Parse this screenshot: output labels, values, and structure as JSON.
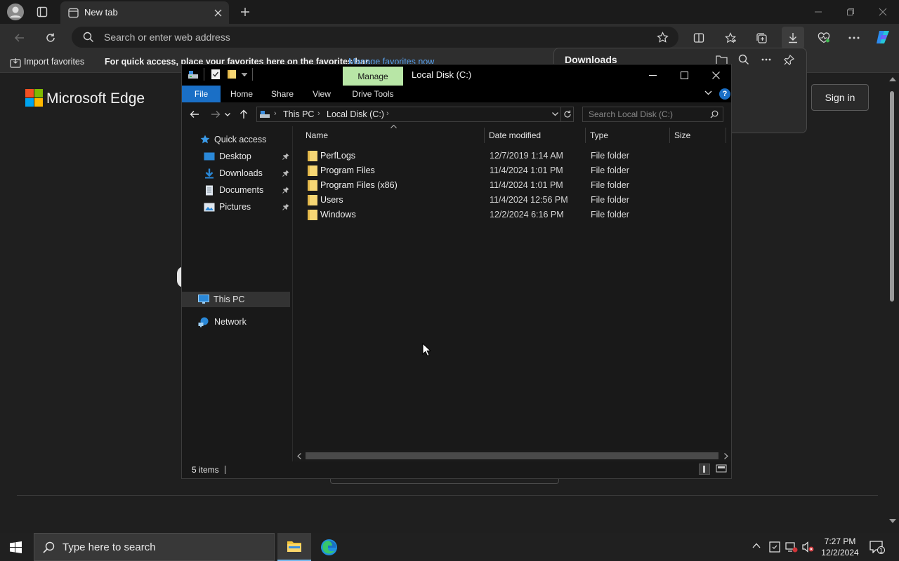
{
  "browser": {
    "tab_title": "New tab",
    "address_placeholder": "Search or enter web address",
    "favorites_bar": {
      "import_label": "Import favorites",
      "message": "For quick access, place your favorites here on the favorites bar.",
      "manage_link": "Manage favorites now"
    },
    "page": {
      "logo_text": "Microsoft Edge",
      "signin_label": "Sign in"
    },
    "downloads_panel": {
      "title": "Downloads"
    },
    "accent_color": "#5aa3f0"
  },
  "explorer": {
    "window_title": "Local Disk (C:)",
    "contextual_tab": "Manage",
    "ribbon_tabs": [
      "File",
      "Home",
      "Share",
      "View",
      "Drive Tools"
    ],
    "breadcrumb": [
      "This PC",
      "Local Disk (C:)"
    ],
    "search_placeholder": "Search Local Disk (C:)",
    "nav": {
      "quick_access": "Quick access",
      "pinned": [
        "Desktop",
        "Downloads",
        "Documents",
        "Pictures"
      ],
      "this_pc": "This PC",
      "network": "Network"
    },
    "columns": {
      "name": "Name",
      "date": "Date modified",
      "type": "Type",
      "size": "Size"
    },
    "files": [
      {
        "name": "PerfLogs",
        "date": "12/7/2019 1:14 AM",
        "type": "File folder"
      },
      {
        "name": "Program Files",
        "date": "11/4/2024 1:01 PM",
        "type": "File folder"
      },
      {
        "name": "Program Files (x86)",
        "date": "11/4/2024 1:01 PM",
        "type": "File folder"
      },
      {
        "name": "Users",
        "date": "11/4/2024 12:56 PM",
        "type": "File folder"
      },
      {
        "name": "Windows",
        "date": "12/2/2024 6:16 PM",
        "type": "File folder"
      }
    ],
    "status": "5 items",
    "accent_color": "#1a6fc6"
  },
  "taskbar": {
    "search_placeholder": "Type here to search",
    "time": "7:27 PM",
    "date": "12/2/2024",
    "notification_count": "1"
  }
}
